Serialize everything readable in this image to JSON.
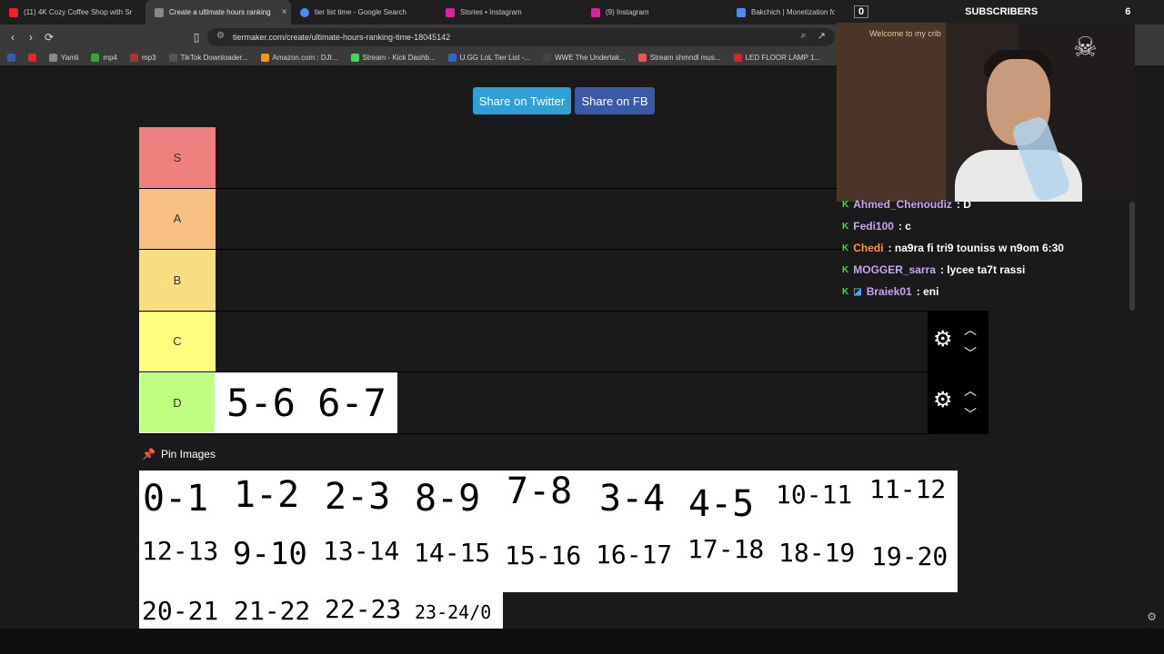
{
  "browser": {
    "tabs": [
      {
        "label": "(11) 4K Cozy Coffee Shop with Sr",
        "color": "#e22"
      },
      {
        "label": "Create a ultimate hours ranking",
        "color": "#888",
        "active": true
      },
      {
        "label": "tier list time - Google Search",
        "color": "#4a8df0"
      },
      {
        "label": "Stories • Instagram",
        "color": "#d6249f"
      },
      {
        "label": "(9) Instagram",
        "color": "#d6249f"
      },
      {
        "label": "Bakchich | Monetization for",
        "color": "#4a8df0"
      }
    ],
    "close_icon": "×",
    "url": "tiermaker.com/create/ultimate-hours-ranking-time-18045142",
    "bookmarks": [
      {
        "label": "Yamli",
        "color": "#888"
      },
      {
        "label": "mp4",
        "color": "#3a3"
      },
      {
        "label": "mp3",
        "color": "#a33"
      },
      {
        "label": "TikTok Downloader...",
        "color": "#333"
      },
      {
        "label": "Amazon.com : DJI...",
        "color": "#f90"
      },
      {
        "label": "Stream - Kick Dashb...",
        "color": "#3ddc55"
      },
      {
        "label": "U.GG LoL Tier List -...",
        "color": "#36c"
      },
      {
        "label": "WWE The Undertak...",
        "color": "#222"
      },
      {
        "label": "Stream shmndl mus...",
        "color": "#e55"
      },
      {
        "label": "LED FLOOR LAMP 1...",
        "color": "#d22"
      }
    ]
  },
  "share": {
    "twitter": "Share on Twitter",
    "facebook": "Share on FB"
  },
  "tiers": [
    {
      "label": "S",
      "color": "#f07f7f"
    },
    {
      "label": "A",
      "color": "#f7bf80"
    },
    {
      "label": "B",
      "color": "#f7de80"
    },
    {
      "label": "C",
      "color": "#fdfe7f"
    },
    {
      "label": "D",
      "color": "#bfff7f"
    }
  ],
  "placed_items": {
    "D": [
      "5-6",
      "6-7"
    ]
  },
  "pin_images": "Pin Images",
  "pool": [
    "0-1",
    "1-2",
    "2-3",
    "8-9",
    "7-8",
    "3-4",
    "4-5",
    "10-11",
    "11-12",
    "12-13",
    "9-10",
    "13-14",
    "14-15",
    "15-16",
    "16-17",
    "17-18",
    "18-19",
    "19-20",
    "20-21",
    "21-22",
    "22-23",
    "23-24/0"
  ],
  "overlay": {
    "subscribers_count": "0",
    "subscribers_label": "SUBSCRIBERS",
    "subscribers_extra": "6",
    "webcam_sign": "Welcome to my crib"
  },
  "chat": [
    {
      "user": "Ahmed_Chenoudiz",
      "text": ": D",
      "color": "#c7a5f0"
    },
    {
      "user": "Fedi100",
      "text": ": c",
      "color": "#c7a5f0"
    },
    {
      "user": "Chedi",
      "text": ": na9ra fi tri9 touniss w n9om 6:30",
      "color": "#ff9a2e"
    },
    {
      "user": "MOGGER_sarra",
      "text": ": lycee ta7t rassi",
      "color": "#c7a5f0"
    },
    {
      "user": "Braiek01",
      "text": ": eni",
      "color": "#c7a5f0"
    }
  ]
}
